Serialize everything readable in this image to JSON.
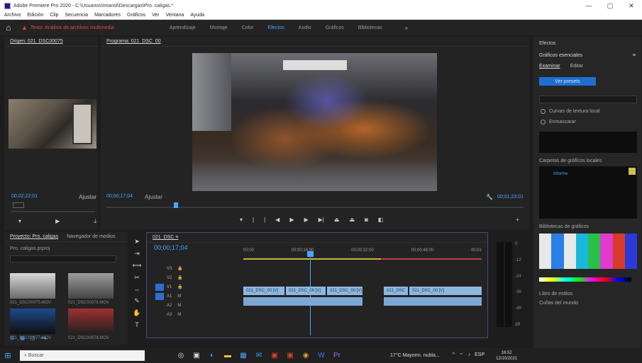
{
  "window": {
    "title": "Adobe Premiere Pro 2020 - C:\\Usuarios\\Imanol\\Descargas\\Pro. caligas.*",
    "controls": [
      "—",
      "▢",
      "✕"
    ]
  },
  "menu": [
    "Archivo",
    "Edición",
    "Clip",
    "Secuencia",
    "Marcadores",
    "Gráficos",
    "Ver",
    "Ventana",
    "Ayuda"
  ],
  "workspace": {
    "warning": "Texto: Análisis de archivos multimedia",
    "tabs": [
      "Aprendizaje",
      "Montaje",
      "Color",
      "Efectos",
      "Audio",
      "Gráficos",
      "Bibliotecas"
    ],
    "active_tab": "Efectos"
  },
  "source": {
    "tabs": [
      "Origen: 021_DSC00075",
      "Mezclador de clips de audio: 021_DSC00075"
    ],
    "timecode": "00;02;22;01",
    "fit": "Ajustar"
  },
  "program": {
    "tab": "Programa: 021_DSC_00",
    "timecode_left": "00;00;17;04",
    "fit": "Ajustar",
    "quality": "1/2",
    "timecode_right": "00;01;23;01"
  },
  "right_panel": {
    "title": "Efectos",
    "section": "Gráficos esenciales",
    "tabs": [
      "Examinar",
      "Editar"
    ],
    "button": "Ver presets",
    "radios": [
      "Curvas de textura local",
      "Enmascarar"
    ],
    "panel2_label": "Carpetas de gráficos locales",
    "panel2_text": "Informe",
    "panel3_label": "Bibliotecas de gráficos",
    "footer": [
      "Libro de estilos",
      "Cuñas del mundo"
    ]
  },
  "project": {
    "tabs": [
      "Proyecto: Pro. caligas",
      "Navegador de medios"
    ],
    "path": "Pro. caligas.prproj",
    "clips": [
      {
        "name": "021_DSC00075.MOV"
      },
      {
        "name": "021_DSC00076.MOV"
      },
      {
        "name": "021_DSC00077.MOV"
      },
      {
        "name": "021_DSC00078.MOV"
      }
    ]
  },
  "timeline": {
    "tab": "021_DSC ≡",
    "timecode": "00;00;17;04",
    "ruler": [
      "00;00",
      "00;00;16;00",
      "00;00;32;00",
      "00;00;48;00",
      "00;01"
    ],
    "tracks": [
      "V3",
      "V2",
      "V1",
      "A1",
      "A2",
      "A3"
    ],
    "clips": [
      {
        "label": "021_DSC_00 [V]"
      },
      {
        "label": "021_DSC_00 [V]"
      },
      {
        "label": "021_DSC_00 [V]"
      },
      {
        "label": "021_DSC"
      },
      {
        "label": "021_DSC_00 [V]"
      }
    ]
  },
  "meters": {
    "scale": [
      "0",
      "-12",
      "-24",
      "-36",
      "-48",
      "dB"
    ]
  },
  "taskbar": {
    "search": "Buscar",
    "weather": "17°C Mayorm. nubla...",
    "time": "16:52",
    "date": "12/10/2021"
  }
}
